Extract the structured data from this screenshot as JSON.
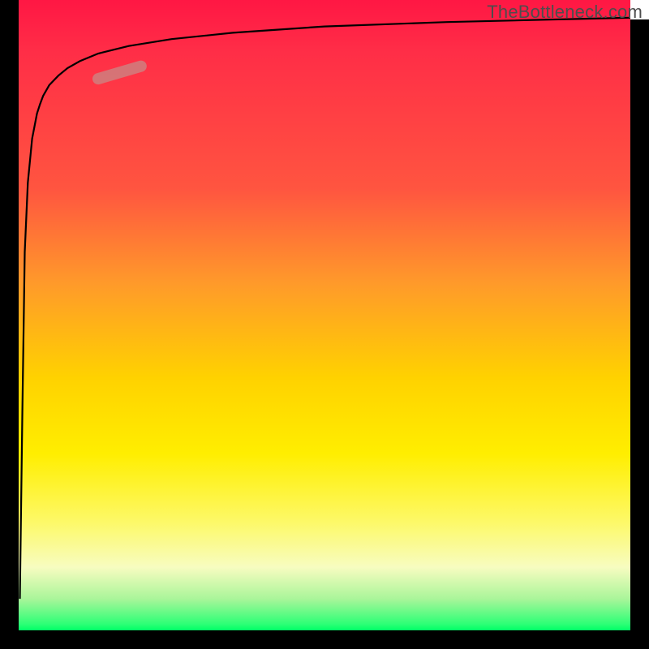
{
  "watermark": "TheBottleneck.com",
  "colors": {
    "top": "#ff1744",
    "mid_orange": "#ff9a2a",
    "mid_yellow": "#ffee00",
    "bottom": "#00ff66",
    "curve": "#000000",
    "marker": "#d07f7f"
  },
  "chart_data": {
    "type": "line",
    "title": "",
    "xlabel": "",
    "ylabel": "",
    "xlim": [
      0,
      100
    ],
    "ylim": [
      0,
      100
    ],
    "grid": false,
    "legend": false,
    "series": [
      {
        "name": "bottleneck-curve",
        "x": [
          0.2,
          0.6,
          1.0,
          1.5,
          2.2,
          3.0,
          3.5,
          4.0,
          5.0,
          6.5,
          8.0,
          10.0,
          13.0,
          18.0,
          25.0,
          35.0,
          50.0,
          70.0,
          100.0
        ],
        "y": [
          5.0,
          34.0,
          60.0,
          71.0,
          78.0,
          82.0,
          83.5,
          84.8,
          86.5,
          88.0,
          89.2,
          90.3,
          91.5,
          92.7,
          93.8,
          94.8,
          95.8,
          96.5,
          97.2
        ]
      }
    ],
    "annotations": [
      {
        "name": "highlight-marker",
        "type": "segment",
        "x": [
          13.0,
          20.0
        ],
        "y": [
          87.5,
          89.5
        ]
      }
    ]
  }
}
